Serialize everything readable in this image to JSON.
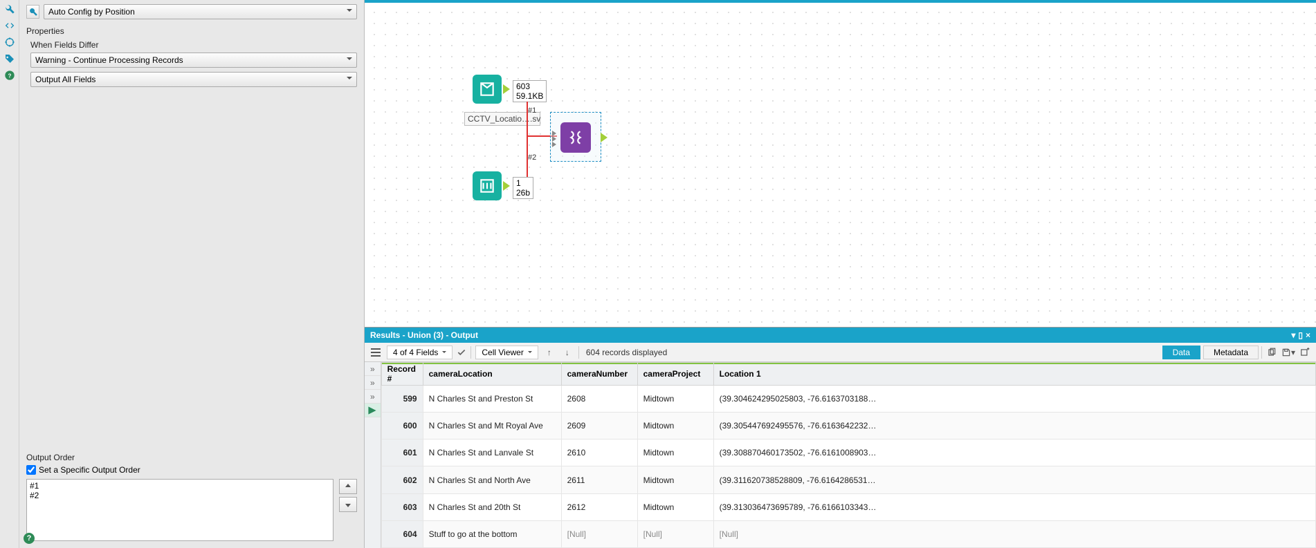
{
  "config": {
    "mode": "Auto Config by Position",
    "propertiesTitle": "Properties",
    "whenDifferLabel": "When Fields Differ",
    "whenDiffer": "Warning - Continue Processing Records",
    "outputFields": "Output All Fields",
    "outputOrderTitle": "Output Order",
    "setOrderLabel": "Set a Specific Output Order",
    "orderItems": [
      "#1",
      "#2"
    ]
  },
  "canvas": {
    "input1": {
      "rows": "603",
      "size": "59.1KB"
    },
    "fileLabel": "CCTV_Locatio….sv",
    "conn1": "#1",
    "conn2": "#2",
    "input2": {
      "rows": "1",
      "size": "26b"
    }
  },
  "results": {
    "title": "Results - Union (3) - Output",
    "fieldsSummary": "4 of 4 Fields",
    "viewer": "Cell Viewer",
    "recCount": "604 records displayed",
    "dataTab": "Data",
    "metaTab": "Metadata",
    "columns": [
      "Record #",
      "cameraLocation",
      "cameraNumber",
      "cameraProject",
      "Location 1"
    ],
    "rows": [
      {
        "rec": "599",
        "loc": "N Charles St and Preston St",
        "num": "2608",
        "proj": "Midtown",
        "coord": "(39.304624295025803, -76.6163703188…"
      },
      {
        "rec": "600",
        "loc": "N Charles St and Mt Royal Ave",
        "num": "2609",
        "proj": "Midtown",
        "coord": "(39.305447692495576, -76.6163642232…"
      },
      {
        "rec": "601",
        "loc": "N Charles St and Lanvale St",
        "num": "2610",
        "proj": "Midtown",
        "coord": "(39.308870460173502, -76.6161008903…"
      },
      {
        "rec": "602",
        "loc": "N Charles St and North Ave",
        "num": "2611",
        "proj": "Midtown",
        "coord": "(39.311620738528809, -76.6164286531…"
      },
      {
        "rec": "603",
        "loc": "N Charles St and 20th St",
        "num": "2612",
        "proj": "Midtown",
        "coord": "(39.313036473695789, -76.6166103343…"
      },
      {
        "rec": "604",
        "loc": "Stuff to go at the bottom",
        "num": "[Null]",
        "proj": "[Null]",
        "coord": "[Null]",
        "null": true
      }
    ]
  }
}
